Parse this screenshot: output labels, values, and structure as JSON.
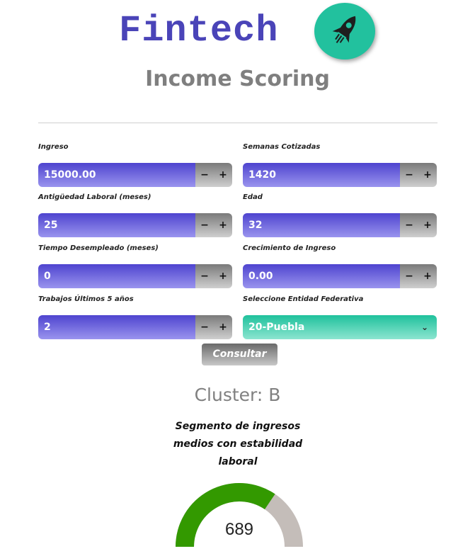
{
  "header": {
    "brand": "Fintech",
    "subtitle": "Income Scoring",
    "logo_icon": "rocket-icon",
    "brand_color": "#4a44b8",
    "logo_color": "#22c19e"
  },
  "form": {
    "ingreso": {
      "label": "Ingreso",
      "value": "15000.00"
    },
    "semanas": {
      "label": "Semanas Cotizadas",
      "value": "1420"
    },
    "antiguedad": {
      "label": "Antigüedad Laboral (meses)",
      "value": "25"
    },
    "edad": {
      "label": "Edad",
      "value": "32"
    },
    "desempleado": {
      "label": "Tiempo Desempleado (meses)",
      "value": "0"
    },
    "crecimiento": {
      "label": "Crecimiento de Ingreso",
      "value": "0.00"
    },
    "trabajos": {
      "label": "Trabajos Últimos 5 años",
      "value": "2"
    },
    "entidad": {
      "label": "Seleccione Entidad Federativa",
      "value": "20-Puebla"
    },
    "stepper": {
      "minus": "−",
      "plus": "+"
    },
    "submit_label": "Consultar"
  },
  "result": {
    "cluster": "Cluster: B",
    "segment": "Segmento de ingresos medios con estabilidad laboral",
    "score": "689",
    "gauge_fraction": 0.69,
    "gauge_fill_color": "#339900",
    "gauge_track_color": "#c4bdb9"
  }
}
